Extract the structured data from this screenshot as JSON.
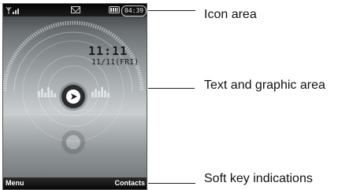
{
  "phone": {
    "status_time": "04:39",
    "clock_time": "11:11",
    "clock_date": "11/11(FRI)",
    "softkey_left": "Menu",
    "softkey_right": "Contacts",
    "icons": [
      "signal-icon",
      "message-icon",
      "battery-icon",
      "clock-icon"
    ]
  },
  "labels": {
    "icon_area": "Icon area",
    "text_graphic_area": "Text and graphic area",
    "softkey_indications": "Soft key indications"
  },
  "colors": {
    "bars": "#0a0a0a",
    "screen_mid": "#c9cdcf",
    "text": "#1a1a1a"
  }
}
